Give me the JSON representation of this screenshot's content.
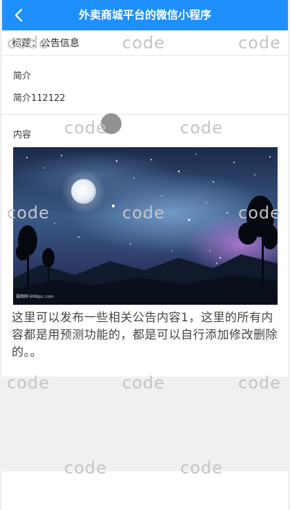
{
  "navbar": {
    "title": "外卖商城平台的微信小程序",
    "back_icon": "chevron-left-icon",
    "color": "#1e8fff"
  },
  "title_row": {
    "label": "标题：公告信息"
  },
  "intro": {
    "label": "简介",
    "value": "简介112122"
  },
  "content": {
    "label": "内容",
    "image_caption": "摄图网 699pic.com",
    "text": "这里可以发布一些相关公告内容1，这里的所有内容都是用预测功能的，都是可以自行添加修改删除的。。"
  },
  "watermark": {
    "text": "code"
  }
}
